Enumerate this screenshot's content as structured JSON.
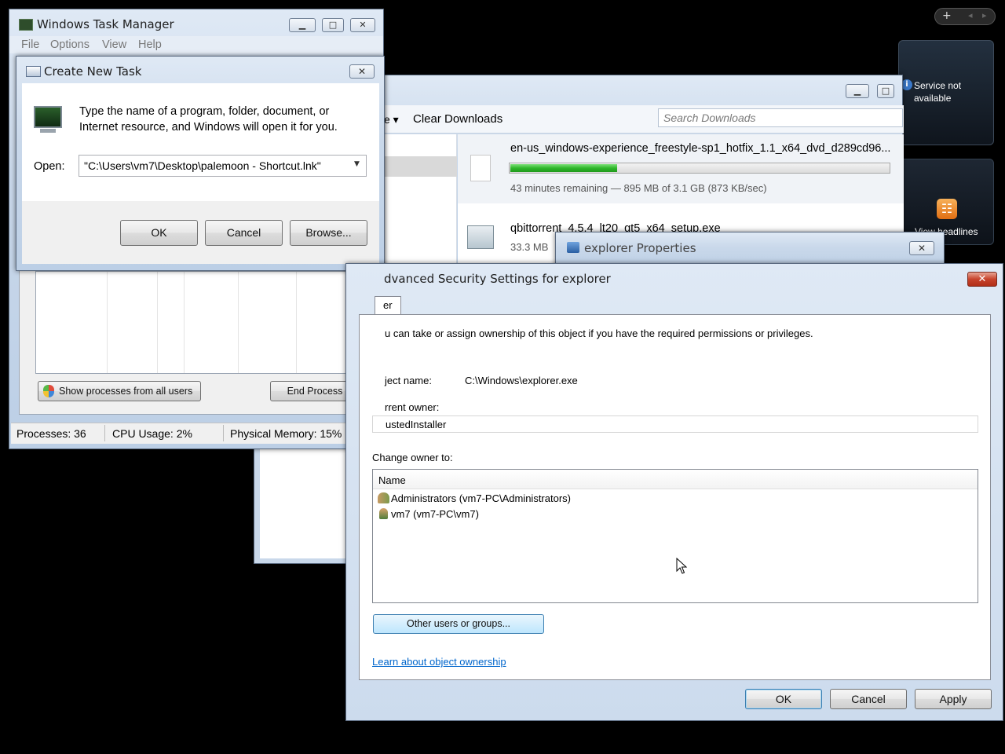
{
  "gadgets": {
    "add_symbol": "+",
    "prev_symbol": "◂",
    "next_symbol": "▸",
    "weather_text": "Service not available",
    "weather_info_icon": "i",
    "feed_text": "View headlines"
  },
  "task_manager": {
    "title": "Windows Task Manager",
    "menu": [
      "File",
      "Options",
      "View",
      "Help"
    ],
    "show_all_label": "Show processes from all users",
    "end_process_label": "End Process",
    "status": {
      "processes": "Processes: 36",
      "cpu": "CPU Usage: 2%",
      "memory": "Physical Memory: 15%"
    }
  },
  "run_dialog": {
    "title": "Create New Task",
    "description_line1": "Type the name of a program, folder, document, or",
    "description_line2": "Internet resource, and Windows will open it for you.",
    "open_label": "Open:",
    "open_value": "\"C:\\Users\\vm7\\Desktop\\palemoon - Shortcut.lnk\"",
    "ok_label": "OK",
    "cancel_label": "Cancel",
    "browse_label": "Browse..."
  },
  "downloads": {
    "toolbar_partial": "e ▾",
    "clear_label": "Clear Downloads",
    "search_placeholder": "Search Downloads",
    "items": [
      {
        "name": "en-us_windows-experience_freestyle-sp1_hotfix_1.1_x64_dvd_d289cd96...",
        "status": "43 minutes remaining — 895 MB of 3.1 GB (873 KB/sec)",
        "progress": 0.28
      },
      {
        "name": "qbittorrent_4.5.4_lt20_qt5_x64_setup.exe",
        "status": "33.3 MB"
      }
    ]
  },
  "explorer_props": {
    "title": "explorer Properties"
  },
  "security": {
    "title": "dvanced Security Settings for explorer",
    "tab_label": "er",
    "intro": "u can take or assign ownership of this object if you have the required permissions or privileges.",
    "object_name_label": "ject name:",
    "object_name_value": "C:\\Windows\\explorer.exe",
    "current_owner_label": "rrent owner:",
    "current_owner_value": "ustedInstaller",
    "change_owner_label": "Change owner to:",
    "column_name": "Name",
    "owners": [
      "Administrators (vm7-PC\\Administrators)",
      "vm7 (vm7-PC\\vm7)"
    ],
    "other_users_label": "Other users or groups...",
    "learn_link": "Learn about object ownership",
    "ok_label": "OK",
    "cancel_label": "Cancel",
    "apply_label": "Apply"
  }
}
